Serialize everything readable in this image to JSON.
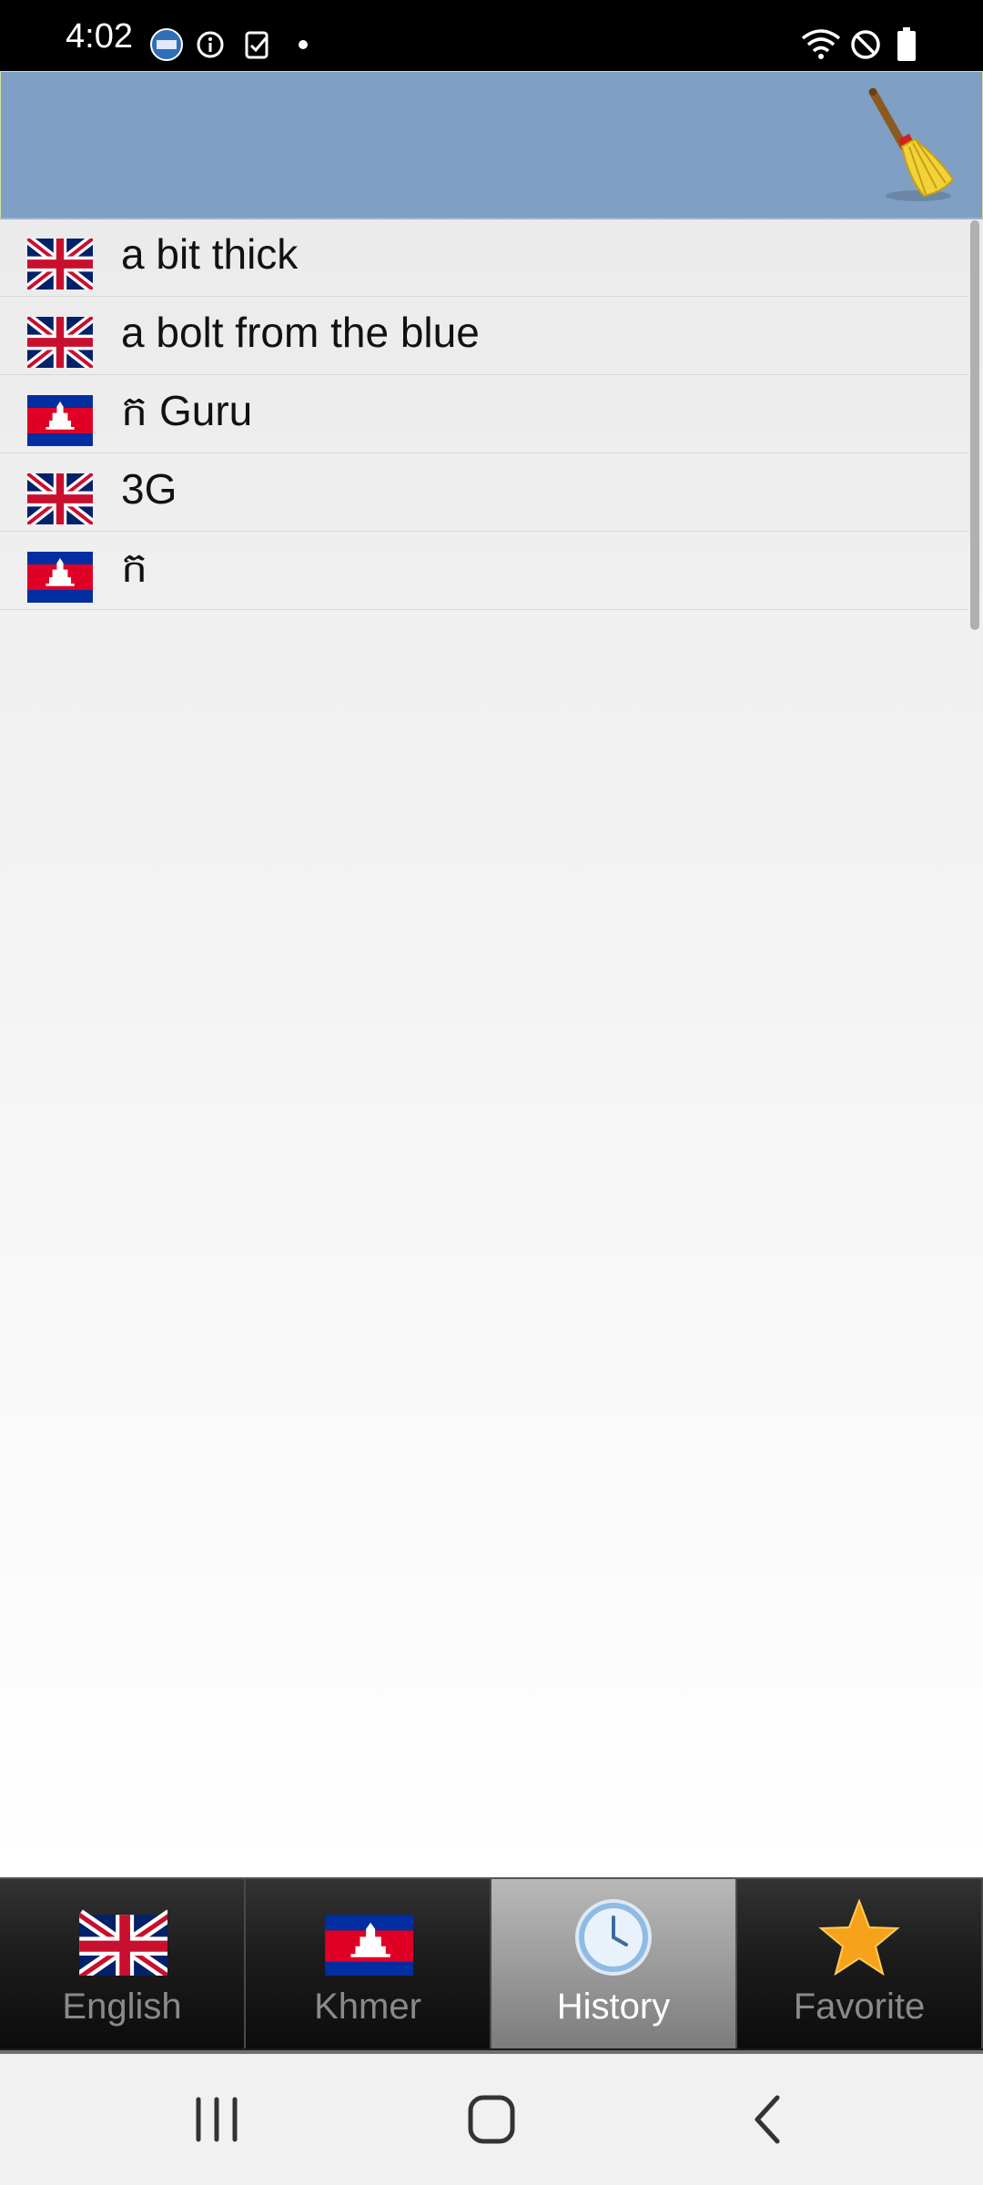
{
  "status_bar": {
    "time": "4:02",
    "left_icons": [
      "test-app-icon",
      "info-icon",
      "clipboard-check-icon",
      "dot-icon"
    ],
    "right_icons": [
      "wifi-icon",
      "do-not-disturb-icon",
      "battery-icon"
    ]
  },
  "toolbar": {
    "clear_icon": "broom-icon"
  },
  "history": [
    {
      "flag": "uk-flag-icon",
      "word": "a bit thick"
    },
    {
      "flag": "uk-flag-icon",
      "word": "a bolt from the blue"
    },
    {
      "flag": "cambodia-flag-icon",
      "word": "ក Guru"
    },
    {
      "flag": "uk-flag-icon",
      "word": "3G"
    },
    {
      "flag": "cambodia-flag-icon",
      "word": "ក"
    }
  ],
  "tabs": [
    {
      "label": "English",
      "icon": "uk-flag-icon",
      "active": false
    },
    {
      "label": "Khmer",
      "icon": "cambodia-flag-icon",
      "active": false
    },
    {
      "label": "History",
      "icon": "clock-icon",
      "active": true
    },
    {
      "label": "Favorite",
      "icon": "star-icon",
      "active": false
    }
  ],
  "nav_bar": {
    "icons": [
      "recent-apps-icon",
      "home-icon",
      "back-icon"
    ]
  },
  "colors": {
    "toolbar": "#7f9fc4",
    "status_bar": "#000000",
    "tab_active": "#9c9c9c",
    "tab_inactive": "#1a1a1a"
  }
}
